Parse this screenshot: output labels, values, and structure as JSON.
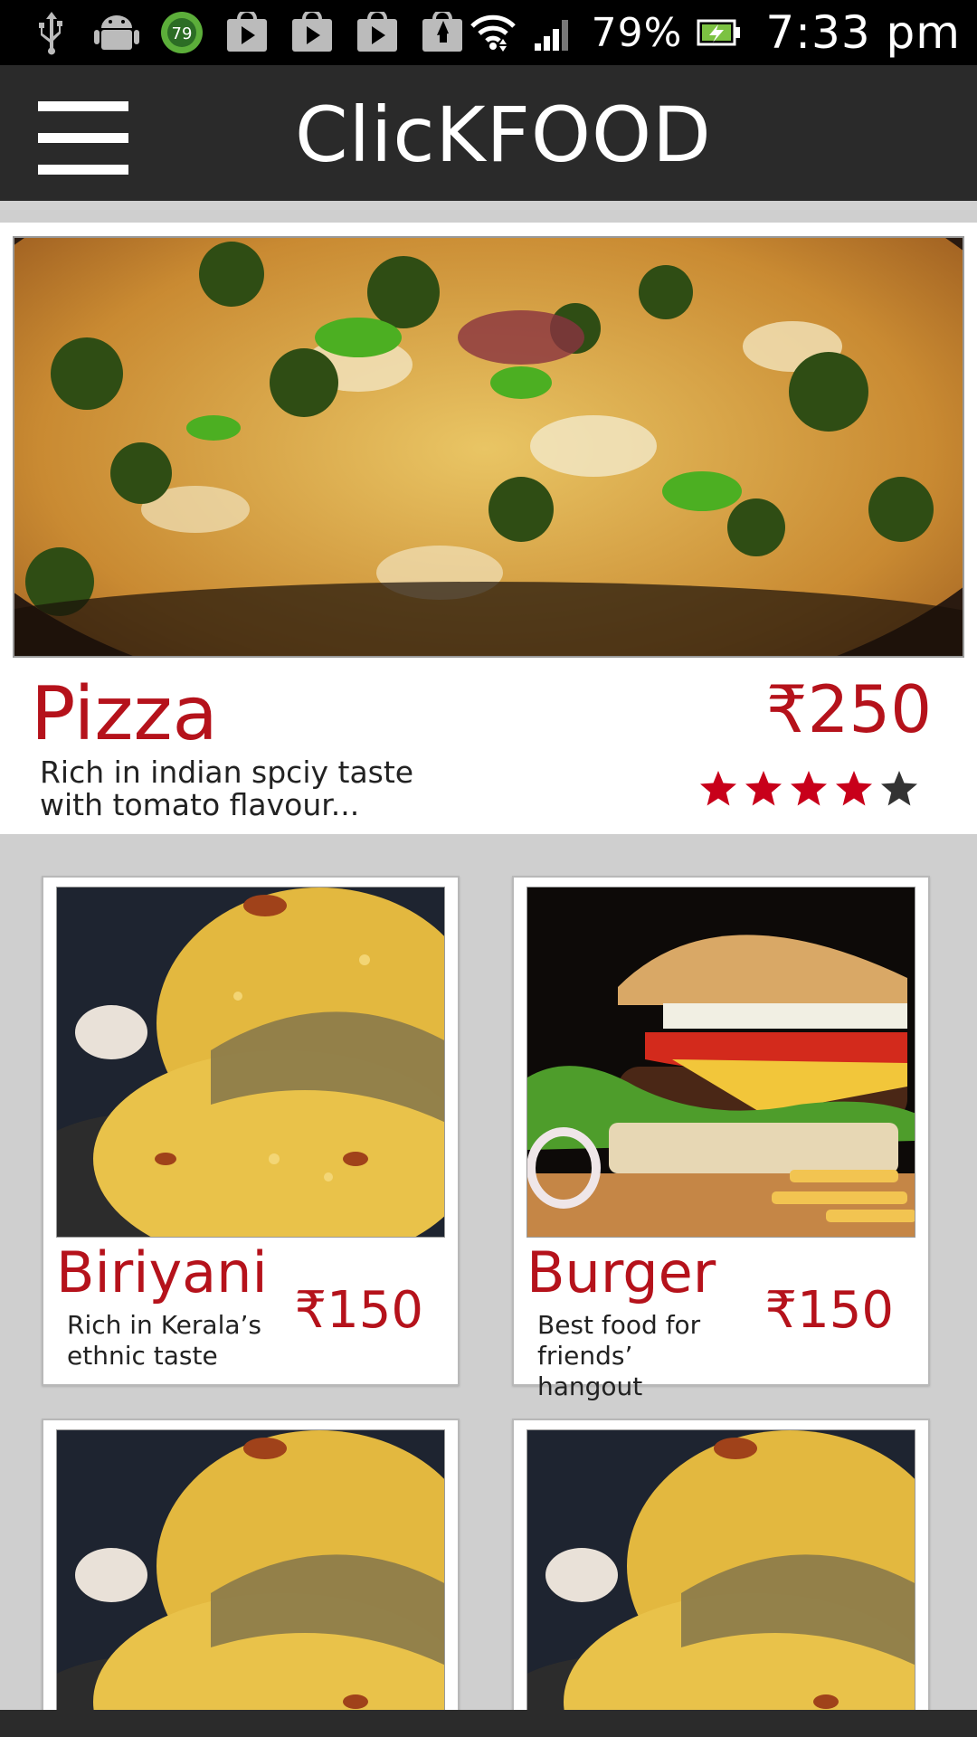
{
  "status_bar": {
    "icons_left": [
      "usb-icon",
      "android-debug-icon",
      "badge-79-icon",
      "play-store-icon",
      "play-store-icon",
      "play-store-icon",
      "play-store-icon"
    ],
    "badge_count": "79",
    "battery": "79%",
    "time": "7:33 pm",
    "icons_right": [
      "wifi-icon",
      "signal-icon",
      "battery-charging-icon"
    ]
  },
  "toolbar": {
    "title": "ClicKFOOD",
    "menu_icon": "hamburger-menu-icon"
  },
  "featured": {
    "name": "Pizza",
    "price": "₹250",
    "description_line1": "Rich in indian spciy taste",
    "description_line2": "with tomato flavour...",
    "rating": 4,
    "rating_max": 5
  },
  "items": [
    {
      "name": "Biriyani",
      "price": "₹150",
      "desc1": "Rich in Kerala’s",
      "desc2": "ethnic taste",
      "image": "biriyani"
    },
    {
      "name": "Burger",
      "price": "₹150",
      "desc1": "Best food for",
      "desc2": "friends’ hangout",
      "image": "burger"
    },
    {
      "name": "",
      "price": "",
      "desc1": "",
      "desc2": "",
      "image": "biriyani"
    },
    {
      "name": "",
      "price": "",
      "desc1": "",
      "desc2": "",
      "image": "biriyani"
    }
  ],
  "colors": {
    "accent_red": "#b5121b",
    "toolbar_bg": "#2a2a2a",
    "page_bg": "#cfcfcf",
    "star_active": "#c8001a",
    "star_inactive": "#333333"
  }
}
